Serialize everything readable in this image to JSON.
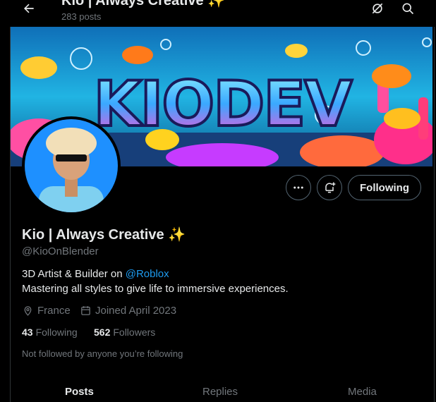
{
  "header": {
    "title": "Kio | Always Creative ✨",
    "post_count": "283 posts"
  },
  "banner": {
    "text": "KIODEV"
  },
  "profile": {
    "name": "Kio | Always Creative ✨",
    "handle": "@KioOnBlender",
    "bio_prefix": "3D Artist & Builder on ",
    "bio_link": "@Roblox",
    "bio_line2": "Mastering all styles to give life to immersive experiences.",
    "location": "France",
    "joined": "Joined April 2023",
    "following_count": "43",
    "following_label": "Following",
    "followers_count": "562",
    "followers_label": "Followers",
    "followed_by_note": "Not followed by anyone you’re following"
  },
  "actions": {
    "follow_label": "Following"
  },
  "tabs": [
    {
      "label": "Posts",
      "active": true
    },
    {
      "label": "Replies",
      "active": false
    },
    {
      "label": "Media",
      "active": false
    }
  ],
  "colors": {
    "accent": "#1d9bf0",
    "muted": "#71767b",
    "border": "#536471"
  }
}
